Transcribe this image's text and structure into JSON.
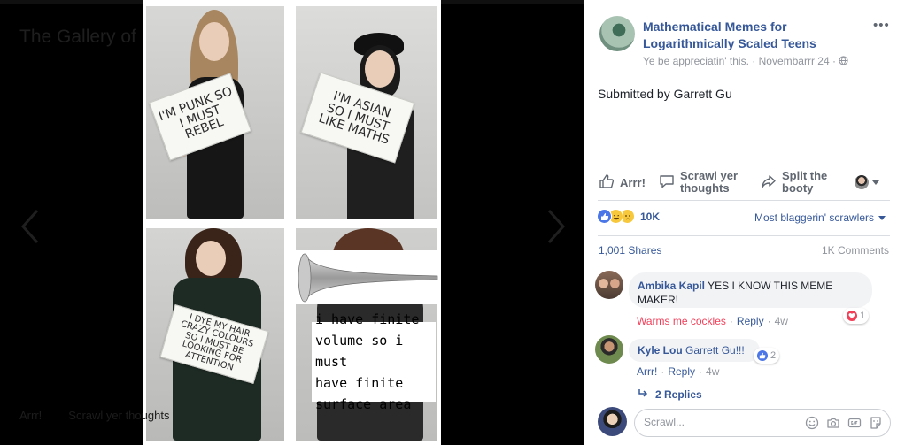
{
  "viewer": {
    "ghost_title": "The Gallery of Mathematical Memes",
    "ghost_like": "Arrr!",
    "ghost_comment": "Scrawl yer thoughts",
    "panel_signs": [
      "I'M PUNK SO\nI MUST\nREBEL",
      "I'M ASIAN\nSO I MUST\nLIKE MATHS",
      "I DYE MY HAIR\nCRAZY COLOURS\nSO I MUST BE\nLOOKING FOR\nATTENTION",
      "i have finite\nvolume so i must\nhave finite\nsurface area"
    ]
  },
  "post": {
    "page_name": "Mathematical Memes for Logarithmically Scaled Teens",
    "meta_text": "Ye be appreciatin' this.",
    "date": "Novembarrr 24",
    "body": "Submitted by Garrett Gu",
    "actions": {
      "like": "Arrr!",
      "comment": "Scrawl yer thoughts",
      "share": "Split the booty"
    },
    "reactions_count": "10K",
    "sort_label": "Most blaggerin' scrawlers",
    "shares": "1,001 Shares",
    "comments_count": "1K Comments"
  },
  "comments": [
    {
      "name": "Ambika Kapil",
      "text": "YES I KNOW THIS MEME MAKER!",
      "like_label": "Warms me cockles",
      "reply_label": "Reply",
      "time": "4w",
      "reactions": "1"
    },
    {
      "name": "Kyle Lou",
      "text": "Garrett Gu!!!",
      "like_label": "Arrr!",
      "reply_label": "Reply",
      "time": "4w",
      "reactions": "2"
    }
  ],
  "replies_link": "2 Replies",
  "composer": {
    "placeholder": "Scrawl..."
  },
  "colors": {
    "link": "#365899",
    "muted": "#90949c",
    "love": "#f33e58",
    "like_blue": "#4a76e8"
  }
}
